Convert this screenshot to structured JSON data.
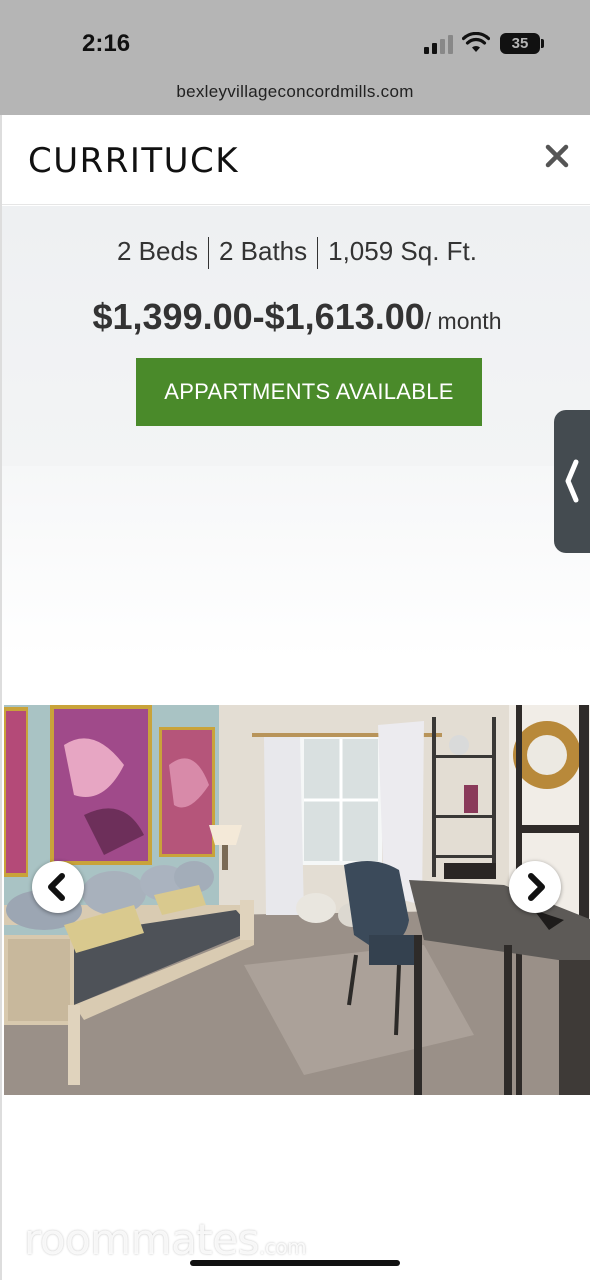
{
  "status_bar": {
    "time": "2:16",
    "battery": "35",
    "icons": [
      "cellular-signal-icon",
      "wifi-icon",
      "battery-icon"
    ]
  },
  "browser": {
    "url": "bexleyvillageconcordmills.com"
  },
  "modal": {
    "title": "CURRITUCK",
    "close_icon": "close-icon",
    "beds": "2 Beds",
    "baths": "2 Baths",
    "area": "1,059 Sq. Ft.",
    "price": "$1,399.00-$1,613.00",
    "price_suffix": "/ month",
    "cta_label": "APPARTMENTS AVAILABLE",
    "accent_color": "#4a8a2a"
  },
  "gallery": {
    "prev_icon": "chevron-left-icon",
    "next_icon": "chevron-right-icon",
    "image_description_icon": "bedroom-office-photo"
  },
  "side_tab": {
    "icon": "chevron-left-icon"
  },
  "watermark": {
    "brand": "roommates",
    "suffix": ".com"
  }
}
